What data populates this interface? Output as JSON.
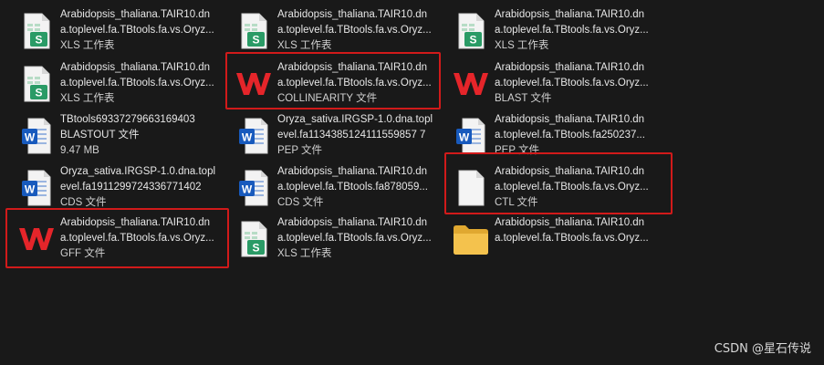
{
  "files": {
    "c1r1": {
      "icon": "xls-spreadsheet-icon",
      "line1": "Arabidopsis_thaliana.TAIR10.dn",
      "line2": "a.toplevel.fa.TBtools.fa.vs.Oryz...",
      "type": "XLS 工作表"
    },
    "c1r2": {
      "icon": "xls-spreadsheet-icon",
      "line1": "Arabidopsis_thaliana.TAIR10.dn",
      "line2": "a.toplevel.fa.TBtools.fa.vs.Oryz...",
      "type": "XLS 工作表"
    },
    "c1r3": {
      "icon": "word-document-icon",
      "line1": "TBtools69337279663169403",
      "line2": "BLASTOUT 文件",
      "type": "9.47 MB"
    },
    "c1r4": {
      "icon": "word-document-icon",
      "line1": "Oryza_sativa.IRGSP-1.0.dna.topl",
      "line2": "evel.fa1911299724336771402",
      "type": "CDS 文件"
    },
    "c1r5": {
      "icon": "wps-logo-icon",
      "line1": "Arabidopsis_thaliana.TAIR10.dn",
      "line2": "a.toplevel.fa.TBtools.fa.vs.Oryz...",
      "type": "GFF 文件"
    },
    "c2r1": {
      "icon": "xls-spreadsheet-icon",
      "line1": "Arabidopsis_thaliana.TAIR10.dn",
      "line2": "a.toplevel.fa.TBtools.fa.vs.Oryz...",
      "type": "XLS 工作表"
    },
    "c2r2": {
      "icon": "wps-logo-icon",
      "line1": "Arabidopsis_thaliana.TAIR10.dn",
      "line2": "a.toplevel.fa.TBtools.fa.vs.Oryz...",
      "type": "COLLINEARITY 文件"
    },
    "c2r3": {
      "icon": "word-document-icon",
      "line1": "Oryza_sativa.IRGSP-1.0.dna.topl",
      "line2": "evel.fa1134385124111559857 7",
      "type": "PEP 文件"
    },
    "c2r4": {
      "icon": "word-document-icon",
      "line1": "Arabidopsis_thaliana.TAIR10.dn",
      "line2": "a.toplevel.fa.TBtools.fa878059...",
      "type": "CDS 文件"
    },
    "c2r5": {
      "icon": "xls-spreadsheet-icon",
      "line1": "Arabidopsis_thaliana.TAIR10.dn",
      "line2": "a.toplevel.fa.TBtools.fa.vs.Oryz...",
      "type": "XLS 工作表"
    },
    "c3r1": {
      "icon": "xls-spreadsheet-icon",
      "line1": "Arabidopsis_thaliana.TAIR10.dn",
      "line2": "a.toplevel.fa.TBtools.fa.vs.Oryz...",
      "type": "XLS 工作表"
    },
    "c3r2": {
      "icon": "wps-logo-icon",
      "line1": "Arabidopsis_thaliana.TAIR10.dn",
      "line2": "a.toplevel.fa.TBtools.fa.vs.Oryz...",
      "type": "BLAST 文件"
    },
    "c3r3": {
      "icon": "word-document-icon",
      "line1": "Arabidopsis_thaliana.TAIR10.dn",
      "line2": "a.toplevel.fa.TBtools.fa250237...",
      "type": "PEP 文件"
    },
    "c3r4": {
      "icon": "blank-file-icon",
      "line1": "Arabidopsis_thaliana.TAIR10.dn",
      "line2": "a.toplevel.fa.TBtools.fa.vs.Oryz...",
      "type": "CTL 文件"
    },
    "c3r5": {
      "icon": "folder-icon",
      "line1": "Arabidopsis_thaliana.TAIR10.dn",
      "line2": "a.toplevel.fa.TBtools.fa.vs.Oryz...",
      "type": ""
    }
  },
  "watermark": "CSDN @星石传说",
  "colors": {
    "background": "#191919",
    "highlight": "#d11a1a",
    "wps_red": "#e5252a",
    "word_blue": "#185abd",
    "xls_green": "#2a9b66",
    "folder_yellow": "#f4c24d"
  }
}
